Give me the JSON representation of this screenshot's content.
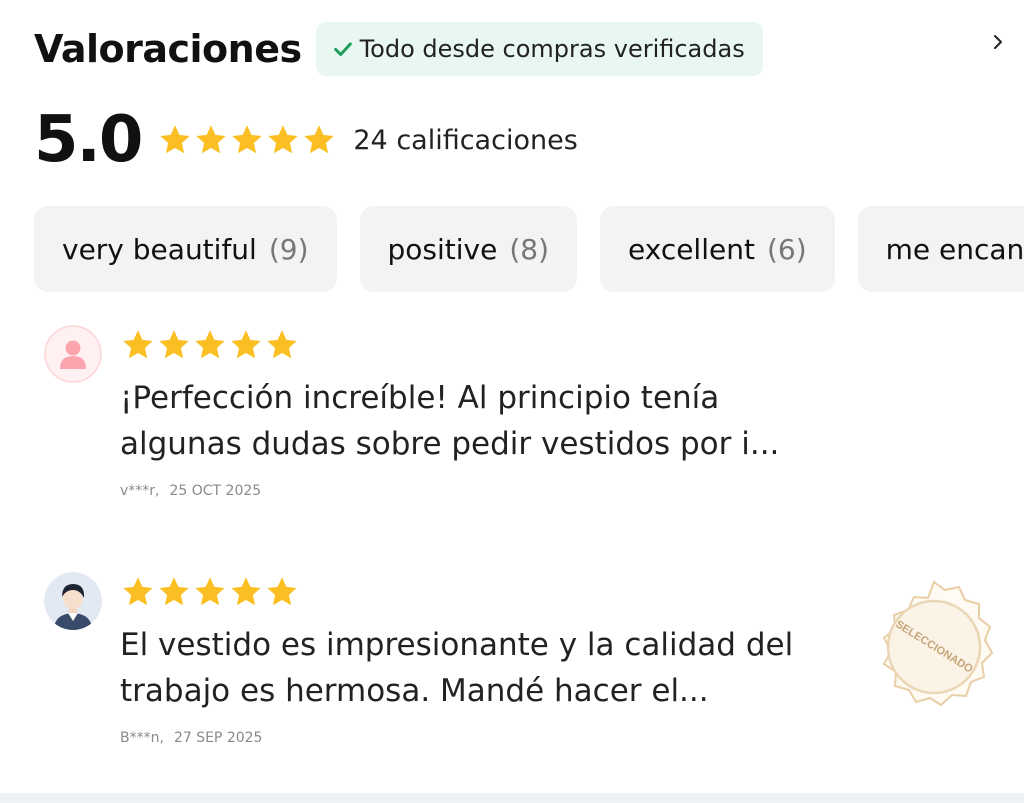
{
  "header": {
    "title": "Valoraciones",
    "verified_badge": "Todo desde compras verificadas",
    "chevron_icon": "chevron-right-icon"
  },
  "summary": {
    "score": "5.0",
    "star_rating": 5,
    "ratings_count": "24 calificaciones"
  },
  "chips": [
    {
      "label": "very beautiful",
      "count": "(9)"
    },
    {
      "label": "positive",
      "count": "(8)"
    },
    {
      "label": "excellent",
      "count": "(6)"
    },
    {
      "label": "me encanta",
      "count": ""
    }
  ],
  "reviews": [
    {
      "avatar": "default-user-avatar",
      "star_rating": 5,
      "text": "¡Perfección increíble! Al principio tenía algunas dudas sobre pedir vestidos por i...",
      "author": "v***r,",
      "date": "25 OCT 2025"
    },
    {
      "avatar": "user-photo-avatar",
      "star_rating": 5,
      "text": "El vestido es impresionante y la calidad del trabajo es hermosa. Mandé hacer el...",
      "author": "B***n,",
      "date": "27 SEP 2025",
      "stamp": "SELECCIONADO"
    }
  ],
  "colors": {
    "star": "#fbbf24",
    "verified_bg": "#e8f7ef",
    "check": "#1a9c5b",
    "chip_bg": "#f3f3f3",
    "stamp": "#e8cfa6"
  }
}
